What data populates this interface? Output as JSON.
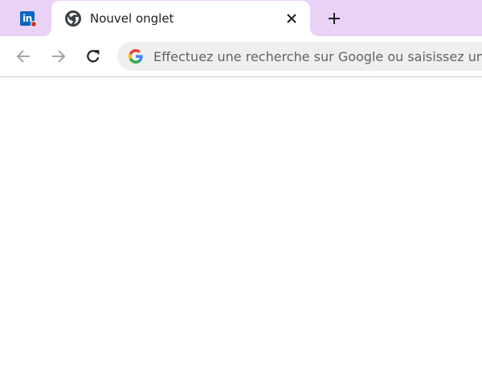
{
  "tabstrip": {
    "pinned_tab": {
      "icon": "linkedin-icon",
      "logo_text": "in",
      "has_notification": true
    },
    "active_tab": {
      "icon": "chrome-icon",
      "title": "Nouvel onglet",
      "close_icon": "close-icon"
    },
    "new_tab_icon": "plus-icon"
  },
  "toolbar": {
    "back_icon": "arrow-left-icon",
    "forward_icon": "arrow-right-icon",
    "reload_icon": "reload-icon",
    "omnibox": {
      "icon": "google-icon",
      "placeholder": "Effectuez une recherche sur Google ou saisissez une URL",
      "value": ""
    }
  },
  "colors": {
    "tabstrip_bg": "#e9d2f6",
    "omnibox_bg": "#efefef",
    "linkedin_blue": "#0a66c2",
    "notification_red": "#d93025",
    "text_primary": "#202124",
    "text_secondary": "#5f6368"
  }
}
